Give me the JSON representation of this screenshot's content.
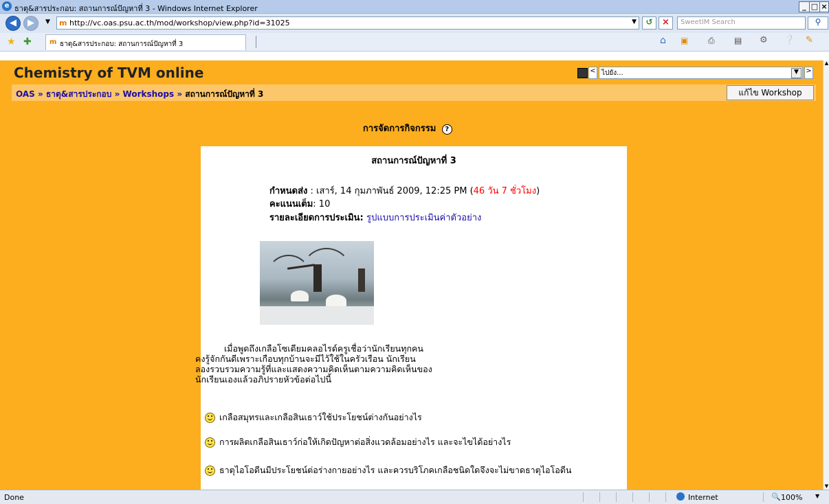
{
  "window": {
    "title": "ธาตุ&สารประกอบ: สถานการณ์ปัญหาที่ 3 - Windows Internet Explorer"
  },
  "toolbar": {
    "address": "http://vc.oas.psu.ac.th/mod/workshop/view.php?id=31025",
    "search_placeholder": "SweetIM Search"
  },
  "tab": {
    "label": "ธาตุ&สารประกอบ: สถานการณ์ปัญหาที่ 3"
  },
  "site": {
    "title": "Chemistry of TVM online",
    "jump_placeholder": "ไปยัง..."
  },
  "breadcrumb": {
    "items": [
      "OAS",
      "ธาตุ&สารประกอบ",
      "Workshops"
    ],
    "separator": "»",
    "current": "สถานการณ์ปัญหาที่ 3",
    "edit_button": "แก้ไข Workshop"
  },
  "main": {
    "manage_heading": "การจัดการกิจกรรม",
    "help_symbol": "?",
    "heading": "สถานการณ์ปัญหาที่ 3",
    "deadline_label": "กำหนดส่ง",
    "deadline_value": " : เสาร์, 14 กุมภาพันธ์ 2009, 12:25 PM (",
    "deadline_remaining": "46 วัน 7 ชั่วโมง",
    "deadline_close": ")",
    "score_label": "คะแนนเต็ม",
    "score_value": ": 10",
    "assessment_label": "รายละเอียดการประเมิน",
    "assessment_link": "รูปแบบการประเมินค่าตัวอย่าง",
    "intro_lines": [
      "เมื่อพูดถึงเกลือโซเดียมคลอไรด์ครูเชื่อว่านักเรียนทุกคน",
      "คงรู้จักกันดีเพราะเกือบทุกบ้านจะมีไว้ใช้ในครัวเรือน นักเรียน",
      "ลองรวบรวมความรู้ที่และแสดงความคิดเห็นตามความคิดเห็นของ",
      "นักเรียนเองแล้วอภิปรายหัวข้อต่อไปนี้"
    ],
    "questions": [
      "เกลือสมุทรและเกลือสินเธาว์ใช้ประโยชน์ต่างกันอย่างไร",
      "การผลิตเกลือสินเธาว์ก่อให้เกิดปัญหาต่อสิ่งแวดล้อมอย่างไร  และจะไขได้อย่างไร",
      "ธาตุไอโอดีนมีประโยชน์ต่อร่างกายอย่างไร  และควรบริโภคเกลือชนิดใดจึงจะไม่ขาดธาตุไอโอดีน"
    ]
  },
  "status": {
    "left": "Done",
    "zone": "Internet",
    "zoom": "100%"
  },
  "colors": {
    "page_background": "#fcae1e",
    "breadcrumb_background": "#fcc66a",
    "link": "#1a0dab",
    "remaining_time": "#ff0000"
  }
}
